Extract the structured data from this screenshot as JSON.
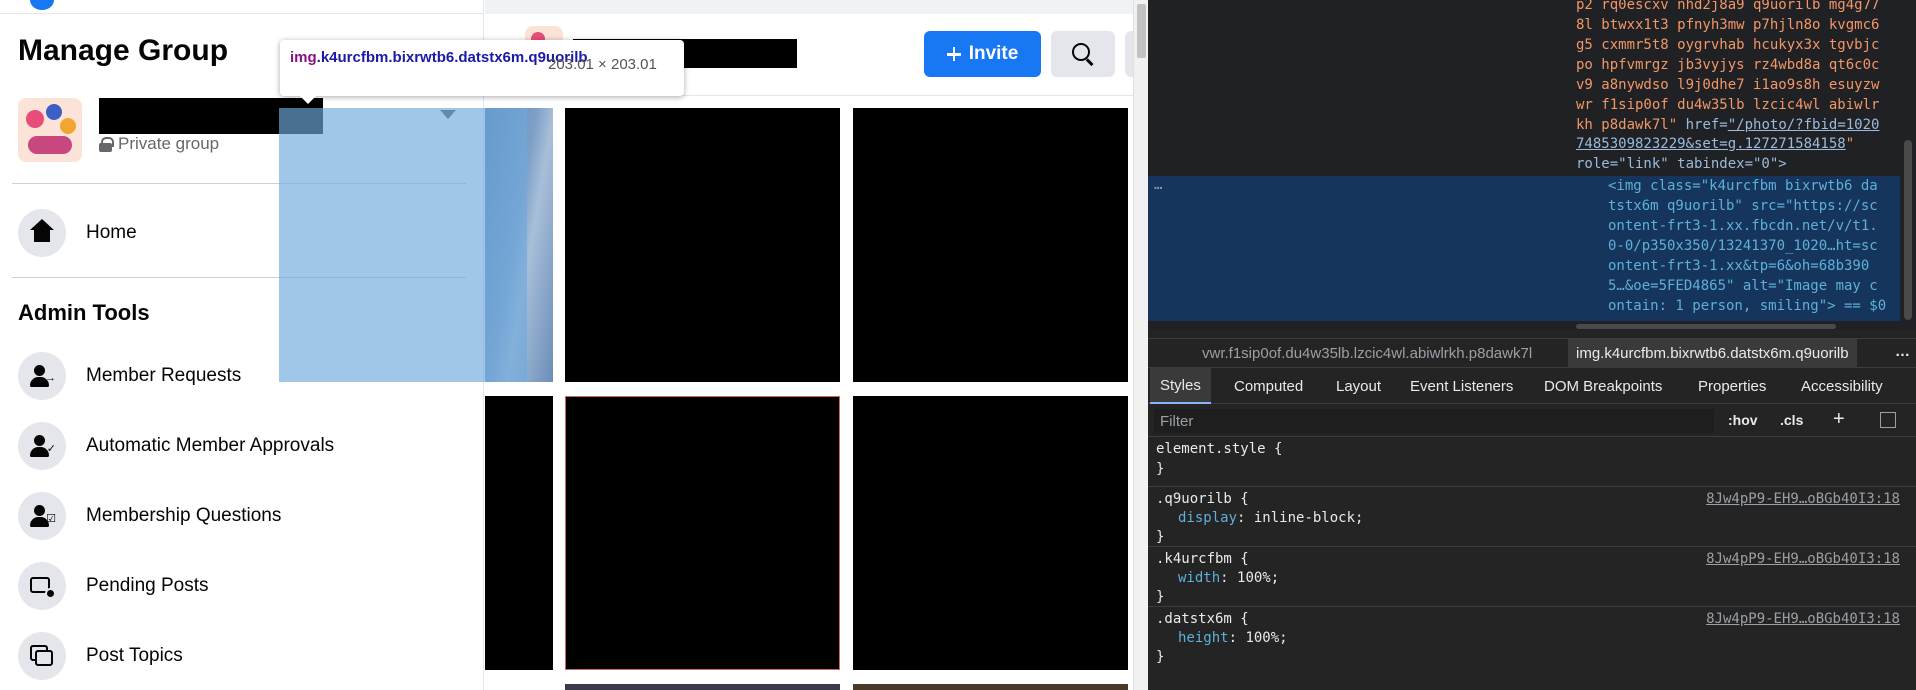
{
  "sidebar": {
    "title": "Manage Group",
    "group_privacy": "Private group",
    "nav": [
      {
        "label": "Home",
        "icon": "home-icon"
      }
    ],
    "section_title": "Admin Tools",
    "admin_items": [
      {
        "label": "Member Requests",
        "icon": "member-requests-icon"
      },
      {
        "label": "Automatic Member Approvals",
        "icon": "auto-approvals-icon"
      },
      {
        "label": "Membership Questions",
        "icon": "membership-questions-icon"
      },
      {
        "label": "Pending Posts",
        "icon": "pending-posts-icon"
      },
      {
        "label": "Post Topics",
        "icon": "post-topics-icon"
      }
    ]
  },
  "header": {
    "invite_label": "Invite",
    "accent_color": "#1877f2"
  },
  "tooltip": {
    "tag": "img",
    "classes": ".k4urcfbm.bixrwtb6.datstx6m.q9uorilb",
    "dimensions": "203.01 × 203.01"
  },
  "devtools": {
    "dom_lines": [
      "p2 rq0escxv nhd2j8a9 q9uorilb mg4g77",
      "8l btwxx1t3 pfnyh3mw p7hjln8o kvgmc6",
      "g5 cxmmr5t8 oygrvhab hcukyx3x tgvbjc",
      "po hpfvmrgz jb3vyjys rz4wbd8a qt6c0c",
      "v9 a8nywdso l9j0dhe7 i1ao9s8h esuyzw",
      "wr f1sip0of du4w35lb lzcic4wl abiwlr",
      "kh p8dawk7l\""
    ],
    "href_attr": "href=",
    "href_value": "\"/photo/?fbid=1020",
    "href_value_2": "7485309823229&set=g.127271584158",
    "href_end": "\"",
    "role_line": "role=\"link\" tabindex=\"0\">",
    "selected_lines": [
      "<img class=\"k4urcfbm bixrwtb6 da",
      "tstx6m q9uorilb\" src=\"https://sc",
      "ontent-frt3-1.xx.fbcdn.net/v/t1.",
      "0-0/p350x350/13241370_1020…ht=sc",
      "ontent-frt3-1.xx&tp=6&oh=68b390",
      "5…&oe=5FED4865\" alt=\"Image may c",
      "ontain: 1 person, smiling\"> == $0"
    ],
    "ellipsis": "…",
    "breadcrumbs": [
      "vwr.f1sip0of.du4w35lb.lzcic4wl.abiwlrkh.p8dawk7l",
      "img.k4urcfbm.bixrwtb6.datstx6m.q9uorilb"
    ],
    "breadcrumb_more": "…",
    "tabs": [
      "Styles",
      "Computed",
      "Layout",
      "Event Listeners",
      "DOM Breakpoints",
      "Properties",
      "Accessibility"
    ],
    "filter_placeholder": "Filter",
    "hov_label": ":hov",
    "cls_label": ".cls",
    "plus_label": "+",
    "rules": [
      {
        "selector": "element.style {",
        "prop": "",
        "value": "",
        "source": ""
      },
      {
        "selector": ".q9uorilb {",
        "prop": "display",
        "value": "inline-block;",
        "source": "8Jw4pP9-EH9…oBGb40I3:18"
      },
      {
        "selector": ".k4urcfbm {",
        "prop": "width",
        "value": "100%;",
        "source": "8Jw4pP9-EH9…oBGb40I3:18"
      },
      {
        "selector": ".datstx6m {",
        "prop": "height",
        "value": "100%;",
        "source": "8Jw4pP9-EH9…oBGb40I3:18"
      }
    ],
    "close_brace": "}"
  }
}
